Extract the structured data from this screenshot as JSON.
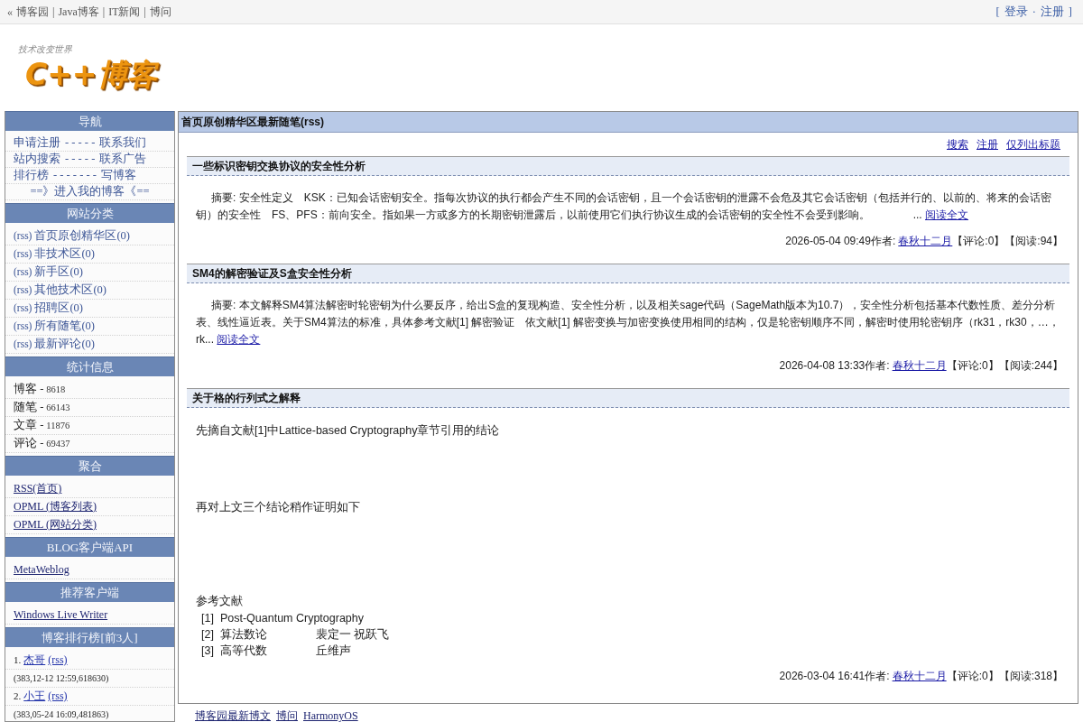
{
  "top_bar": {
    "left": [
      {
        "prefix": "«",
        "text": "博客园"
      },
      {
        "prefix": "|",
        "text": "Java博客"
      },
      {
        "prefix": "|",
        "text": "IT新闻"
      },
      {
        "prefix": "|",
        "text": "博问"
      }
    ],
    "right": {
      "open": "[",
      "links": [
        {
          "text": "登录"
        },
        {
          "prefix": "·",
          "text": "注册"
        }
      ],
      "close": "]"
    }
  },
  "logo": {
    "tagline": "技术改变世界",
    "title": "C++博客"
  },
  "sidebar": {
    "sections": [
      {
        "title": "导航",
        "kind": "nav",
        "rows": [
          {
            "kind": "pair",
            "left": "申请注册",
            "dashes": "- - - - -",
            "right": "联系我们"
          },
          {
            "kind": "pair",
            "left": "站内搜索",
            "dashes": "- - - - -",
            "right": "联系广告"
          },
          {
            "kind": "pair",
            "left": "排行榜",
            "dashes": "- - - - - - -",
            "right": "写博客"
          },
          {
            "kind": "center",
            "text": "==》进入我的博客《=="
          }
        ]
      },
      {
        "title": "网站分类",
        "kind": "categories",
        "items": [
          {
            "rss": "(rss)",
            "label": "首页原创精华区(0)"
          },
          {
            "rss": "(rss)",
            "label": "非技术区(0)"
          },
          {
            "rss": "(rss)",
            "label": "新手区(0)"
          },
          {
            "rss": "(rss)",
            "label": "其他技术区(0)"
          },
          {
            "rss": "(rss)",
            "label": "招聘区(0)"
          },
          {
            "rss": "(rss)",
            "label": "所有随笔(0)"
          },
          {
            "rss": "(rss)",
            "label": "最新评论(0)"
          }
        ]
      },
      {
        "title": "统计信息",
        "kind": "stats",
        "items": [
          {
            "label": "博客 -",
            "value": "8618"
          },
          {
            "label": "随笔 -",
            "value": "66143"
          },
          {
            "label": "文章 -",
            "value": "11876"
          },
          {
            "label": "评论 -",
            "value": "69437"
          }
        ]
      },
      {
        "title": "聚合",
        "kind": "links",
        "items": [
          "RSS(首页)",
          "OPML (博客列表)",
          "OPML (网站分类)"
        ]
      },
      {
        "title": "BLOG客户端API",
        "kind": "links",
        "items": [
          "MetaWeblog"
        ]
      },
      {
        "title": "推荐客户端",
        "kind": "links",
        "items": [
          "Windows Live Writer"
        ]
      },
      {
        "title": "博客排行榜[前3人]",
        "kind": "ranking",
        "items": [
          {
            "rank": "1.",
            "name": "杰哥",
            "rss": "(rss)",
            "detail": "(383,12-12 12:59,618630)"
          },
          {
            "rank": "2.",
            "name": "小王",
            "rss": "(rss)",
            "detail": "(383,05-24 16:09,481863)"
          }
        ]
      }
    ]
  },
  "main": {
    "title": "首页原创精华区最新随笔(rss)",
    "toolbar": [
      "搜索",
      "注册",
      "仅列出标题"
    ],
    "posts": [
      {
        "kind": "summary",
        "title": "一些标识密钥交换协议的安全性分析",
        "summary": "摘要: 安全性定义　KSK：已知会话密钥安全。指每次协议的执行都会产生不同的会话密钥，且一个会话密钥的泄露不会危及其它会话密钥（包括并行的、以前的、将来的会话密钥）的安全性　FS、PFS：前向安全。指如果一方或多方的长期密钥泄露后，以前使用它们执行协议生成的会话密钥的安全性不会受到影响。　　　　...",
        "more": "阅读全文",
        "meta": {
          "date": "2026-05-04 09:49",
          "author_label": "作者:",
          "author": "春秋十二月",
          "counts": "【评论:0】【阅读:94】"
        }
      },
      {
        "kind": "summary",
        "title": "SM4的解密验证及S盒安全性分析",
        "summary": "摘要: 本文解释SM4算法解密时轮密钥为什么要反序，给出S盒的复现构造、安全性分析，以及相关sage代码（SageMath版本为10.7），安全性分析包括基本代数性质、差分分析表、线性逼近表。关于SM4算法的标准，具体参考文献[1] 解密验证　依文献[1] 解密变换与加密变换使用相同的结构，仅是轮密钥顺序不同，解密时使用轮密钥序（rk31，rk30，…，rk...",
        "more": "阅读全文",
        "meta": {
          "date": "2026-04-08 13:33",
          "author_label": "作者:",
          "author": "春秋十二月",
          "counts": "【评论:0】【阅读:244】"
        }
      },
      {
        "kind": "article",
        "title": "关于格的行列式之解释",
        "paragraphs": [
          "先摘自文献[1]中Lattice-based Cryptography章节引用的结论",
          "再对上文三个结论稍作证明如下"
        ],
        "references_title": "参考文献",
        "references": [
          {
            "number": "[1]",
            "title": "Post-Quantum Cryptography"
          },
          {
            "number": "[2]",
            "title": "算法数论",
            "authors": "裴定一 祝跃飞"
          },
          {
            "number": "[3]",
            "title": "高等代数",
            "authors": "丘维声"
          }
        ],
        "meta": {
          "date": "2026-03-04 16:41",
          "author_label": "作者:",
          "author": "春秋十二月",
          "counts": "【评论:0】【阅读:318】"
        }
      }
    ]
  },
  "footer": {
    "links": [
      "博客园最新博文",
      "博问",
      "HarmonyOS"
    ]
  }
}
